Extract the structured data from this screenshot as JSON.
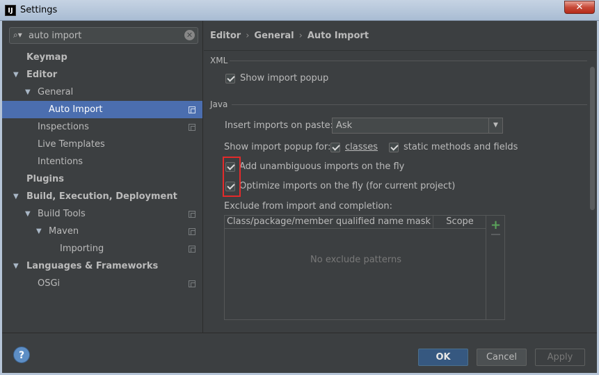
{
  "window": {
    "title": "Settings",
    "app_icon": "IJ",
    "close_label": "✕"
  },
  "search": {
    "value": "auto import",
    "clear_label": "✕"
  },
  "tree": [
    {
      "label": "Keymap",
      "arrow": ""
    },
    {
      "label": "Editor",
      "arrow": "▼"
    },
    {
      "label": "General",
      "arrow": "▼"
    },
    {
      "label": "Auto Import",
      "arrow": ""
    },
    {
      "label": "Inspections",
      "arrow": ""
    },
    {
      "label": "Live Templates",
      "arrow": ""
    },
    {
      "label": "Intentions",
      "arrow": ""
    },
    {
      "label": "Plugins",
      "arrow": ""
    },
    {
      "label": "Build, Execution, Deployment",
      "arrow": "▼"
    },
    {
      "label": "Build Tools",
      "arrow": "▼"
    },
    {
      "label": "Maven",
      "arrow": "▼"
    },
    {
      "label": "Importing",
      "arrow": ""
    },
    {
      "label": "Languages & Frameworks",
      "arrow": "▼"
    },
    {
      "label": "OSGi",
      "arrow": ""
    }
  ],
  "breadcrumb": {
    "items": [
      "Editor",
      "General",
      "Auto Import"
    ],
    "separator": "›"
  },
  "xml": {
    "section": "XML",
    "show_import_popup": {
      "label": "Show import popup",
      "checked": true
    }
  },
  "java": {
    "section": "Java",
    "insert_on_paste_label": "Insert imports on paste:",
    "insert_on_paste_value": "Ask",
    "combo_arrow": "▼",
    "show_popup_for_label": "Show import popup for:",
    "classes": {
      "label": "classes",
      "checked": true
    },
    "static_methods": {
      "label": "static methods and fields",
      "checked": true
    },
    "add_unambiguous": {
      "label": "Add unambiguous imports on the fly",
      "checked": true
    },
    "optimize_imports": {
      "label": "Optimize imports on the fly (for current project)",
      "checked": true
    },
    "exclude_label": "Exclude from import and completion:",
    "table": {
      "columns": [
        "Class/package/member qualified name mask",
        "Scope"
      ],
      "empty_message": "No exclude patterns",
      "add_label": "+"
    }
  },
  "footer": {
    "help_label": "?",
    "ok_label": "OK",
    "cancel_label": "Cancel",
    "apply_label": "Apply"
  },
  "colors": {
    "background": "#3c3f41",
    "selection": "#4b6eaf",
    "highlight_box": "#e32a2a",
    "ok_button": "#365880"
  }
}
